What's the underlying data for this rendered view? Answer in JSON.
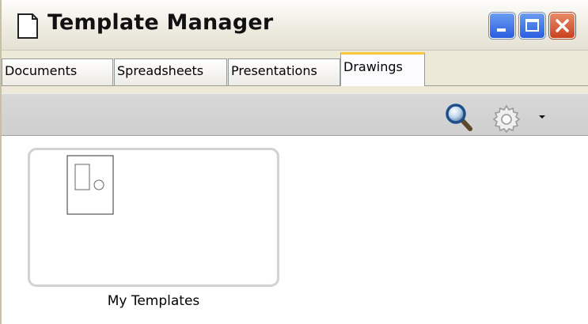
{
  "window": {
    "title": "Template Manager"
  },
  "tabs": [
    {
      "label": "Documents",
      "active": false
    },
    {
      "label": "Spreadsheets",
      "active": false
    },
    {
      "label": "Presentations",
      "active": false
    },
    {
      "label": "Drawings",
      "active": true
    }
  ],
  "toolbar": {
    "search_icon": "magnifier-icon",
    "settings_icon": "gear-icon",
    "dropdown_icon": "triangle-down-icon"
  },
  "folders": [
    {
      "label": "My Templates",
      "icon": "drawing-thumbnail-icon"
    }
  ],
  "colors": {
    "active_tab_accent": "#ffc83c",
    "close_button": "#c9411e",
    "caption_button": "#2a5ee0"
  }
}
